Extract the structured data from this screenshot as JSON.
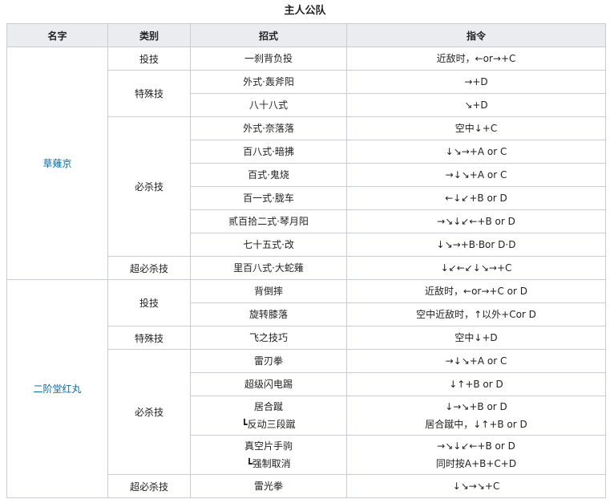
{
  "title": "主人公队",
  "headers": [
    "名字",
    "类别",
    "招式",
    "指令"
  ],
  "fighters": [
    {
      "name": "草薙京",
      "groups": [
        {
          "category": "投技",
          "moves": [
            {
              "name": [
                "一刹背负投"
              ],
              "cmd": [
                "近敌时，←or→+C"
              ]
            }
          ]
        },
        {
          "category": "特殊技",
          "moves": [
            {
              "name": [
                "外式·轰斧阳"
              ],
              "cmd": [
                "→+D"
              ]
            },
            {
              "name": [
                "八十八式"
              ],
              "cmd": [
                "↘+D"
              ]
            }
          ]
        },
        {
          "category": "必杀技",
          "moves": [
            {
              "name": [
                "外式·奈落落"
              ],
              "cmd": [
                "空中↓+C"
              ]
            },
            {
              "name": [
                "百八式·暗拂"
              ],
              "cmd": [
                "↓↘→+A or C"
              ]
            },
            {
              "name": [
                "百式·鬼烧"
              ],
              "cmd": [
                "→↓↘+A or C"
              ]
            },
            {
              "name": [
                "百一式·胧车"
              ],
              "cmd": [
                "←↓↙+B or D"
              ]
            },
            {
              "name": [
                "贰百拾二式·琴月阳"
              ],
              "cmd": [
                "→↘↓↙←+B or D"
              ]
            },
            {
              "name": [
                "七十五式·改"
              ],
              "cmd": [
                "↓↘→+B·Bor D·D"
              ]
            }
          ]
        },
        {
          "category": "超必杀技",
          "moves": [
            {
              "name": [
                "里百八式·大蛇薙"
              ],
              "cmd": [
                "↓↙←↙↓↘→+C"
              ]
            }
          ]
        }
      ]
    },
    {
      "name": "二阶堂红丸",
      "groups": [
        {
          "category": "投技",
          "moves": [
            {
              "name": [
                "背倒摔"
              ],
              "cmd": [
                "近敌时，←or→+C or D"
              ]
            },
            {
              "name": [
                "旋转膝落"
              ],
              "cmd": [
                "空中近敌时，↑以外+Cor D"
              ]
            }
          ]
        },
        {
          "category": "特殊技",
          "moves": [
            {
              "name": [
                "飞之技巧"
              ],
              "cmd": [
                "空中↓+D"
              ]
            }
          ]
        },
        {
          "category": "必杀技",
          "moves": [
            {
              "name": [
                "雷刃拳"
              ],
              "cmd": [
                "→↓↘+A or C"
              ]
            },
            {
              "name": [
                "超级闪电踢"
              ],
              "cmd": [
                "↓↑+B or D"
              ]
            },
            {
              "name": [
                "居合蹴",
                "┗反动三段蹴"
              ],
              "cmd": [
                "↓→↘+B or D",
                "居合蹴中，↓↑+B or D"
              ]
            },
            {
              "name": [
                "真空片手驹",
                "┗强制取消"
              ],
              "cmd": [
                "→↘↓↙←+B or D",
                "同时按A+B+C+D"
              ]
            }
          ]
        },
        {
          "category": "超必杀技",
          "moves": [
            {
              "name": [
                "雷光拳"
              ],
              "cmd": [
                "↓↘→↘+C"
              ]
            }
          ]
        }
      ]
    }
  ]
}
